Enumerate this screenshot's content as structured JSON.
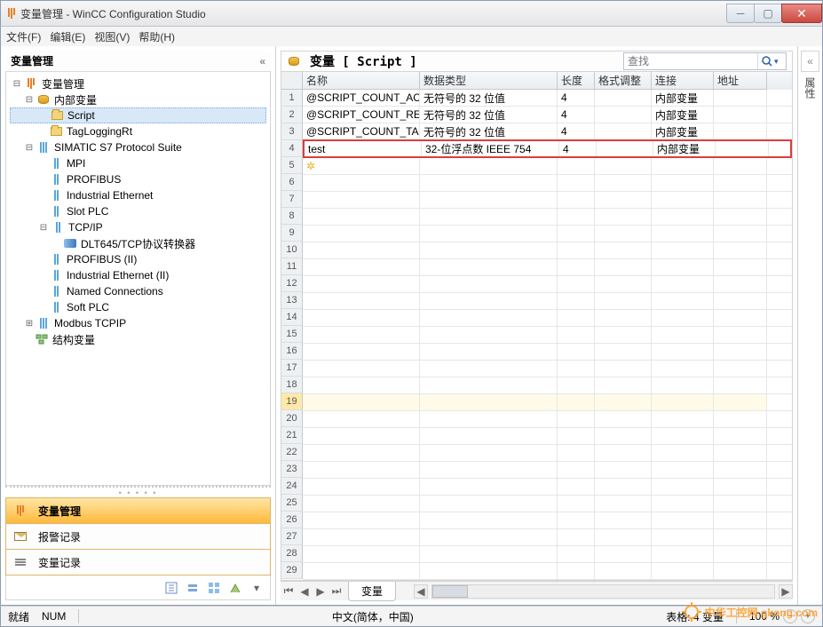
{
  "window": {
    "title": "变量管理 - WinCC Configuration Studio"
  },
  "menu": {
    "file": "文件(F)",
    "edit": "编辑(E)",
    "view": "视图(V)",
    "help": "帮助(H)"
  },
  "leftPanel": {
    "title": "变量管理",
    "collapse": "«"
  },
  "tree": {
    "root": "变量管理",
    "internal": "内部变量",
    "script": "Script",
    "tagLogging": "TagLoggingRt",
    "simatic": "SIMATIC S7 Protocol Suite",
    "mpi": "MPI",
    "profibus": "PROFIBUS",
    "indEth": "Industrial Ethernet",
    "slotPlc": "Slot PLC",
    "tcpip": "TCP/IP",
    "dlt": "DLT645/TCP协议转换器",
    "profibus2": "PROFIBUS (II)",
    "indEth2": "Industrial Ethernet (II)",
    "namedConn": "Named Connections",
    "softPlc": "Soft PLC",
    "modbus": "Modbus TCPIP",
    "struct": "结构变量"
  },
  "nav": {
    "varMgmt": "变量管理",
    "alarmLog": "报警记录",
    "varLog": "变量记录"
  },
  "grid": {
    "title": "变量 [ Script ]",
    "searchPlaceholder": "查找",
    "cols": {
      "name": "名称",
      "dataType": "数据类型",
      "length": "长度",
      "format": "格式调整",
      "connection": "连接",
      "address": "地址"
    },
    "rows": [
      {
        "name": "@SCRIPT_COUNT_ACT",
        "dataType": "无符号的 32 位值",
        "length": "4",
        "format": "",
        "connection": "内部变量",
        "address": ""
      },
      {
        "name": "@SCRIPT_COUNT_REQ",
        "dataType": "无符号的 32 位值",
        "length": "4",
        "format": "",
        "connection": "内部变量",
        "address": ""
      },
      {
        "name": "@SCRIPT_COUNT_TAG",
        "dataType": "无符号的 32 位值",
        "length": "4",
        "format": "",
        "connection": "内部变量",
        "address": ""
      },
      {
        "name": "test",
        "dataType": "32-位浮点数 IEEE 754",
        "length": "4",
        "format": "",
        "connection": "内部变量",
        "address": ""
      }
    ],
    "highlightIndex": 3,
    "selectedRowIndex": 18,
    "sheetTab": "变量"
  },
  "rightPanel": {
    "expand": "«",
    "title": "属性"
  },
  "status": {
    "ready": "就绪",
    "num": "NUM",
    "lang": "中文(简体，中国)",
    "grid": "表格: 4 变量",
    "zoom": "100 %"
  },
  "watermark": "中华工控网 gkong.com"
}
